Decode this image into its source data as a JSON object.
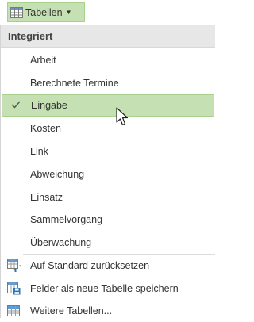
{
  "toolbar": {
    "tables_button_label": "Tabellen",
    "icon": "table-icon"
  },
  "menu": {
    "section_header": "Integriert",
    "items": [
      {
        "label": "Arbeit"
      },
      {
        "label": "Berechnete Termine"
      },
      {
        "label": "Eingabe",
        "checked": true
      },
      {
        "label": "Kosten"
      },
      {
        "label": "Link"
      },
      {
        "label": "Abweichung"
      },
      {
        "label": "Einsatz"
      },
      {
        "label": "Sammelvorgang"
      },
      {
        "label": "Überwachung"
      }
    ],
    "actions": [
      {
        "label": "Auf Standard zurücksetzen",
        "icon": "reset-table-icon"
      },
      {
        "label": "Felder als neue Tabelle speichern",
        "icon": "save-table-icon"
      },
      {
        "label": "Weitere Tabellen...",
        "icon": "more-tables-icon"
      }
    ]
  },
  "colors": {
    "highlight": "#c5e0b3",
    "highlight_border": "#a9d18e",
    "header_bg": "#e7e7e7"
  }
}
